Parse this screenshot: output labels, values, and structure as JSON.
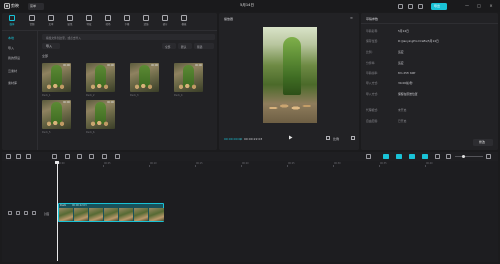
{
  "titlebar": {
    "app_name": "剪映",
    "menu_label": "菜单",
    "doc_title": "5月14日",
    "export_label": "导出",
    "window_controls": [
      "—",
      "□",
      "×"
    ]
  },
  "media_tools": [
    {
      "label": "媒体",
      "icon": "media-icon",
      "active": true
    },
    {
      "label": "音频",
      "icon": "audio-icon",
      "active": false
    },
    {
      "label": "文本",
      "icon": "text-icon",
      "active": false
    },
    {
      "label": "贴纸",
      "icon": "sticker-icon",
      "active": false
    },
    {
      "label": "特效",
      "icon": "effects-icon",
      "active": false
    },
    {
      "label": "转场",
      "icon": "transition-icon",
      "active": false
    },
    {
      "label": "字幕",
      "icon": "subtitle-icon",
      "active": false
    },
    {
      "label": "滤镜",
      "icon": "filter-icon",
      "active": false
    },
    {
      "label": "调节",
      "icon": "adjust-icon",
      "active": false
    },
    {
      "label": "模板",
      "icon": "template-icon",
      "active": false
    }
  ],
  "sidebar": {
    "items": [
      {
        "label": "本地",
        "active": true
      },
      {
        "label": "导入",
        "active": false
      },
      {
        "label": "我的预设",
        "active": false
      },
      {
        "label": "云素材",
        "active": false
      },
      {
        "label": "素材库",
        "active": false
      }
    ]
  },
  "import_bar": {
    "placeholder": "拖拽文件到这里，或点击导入"
  },
  "import_button": {
    "label": "导入"
  },
  "filters": {
    "all_label": "全部",
    "sort_label": "默认",
    "filter_label": "筛选"
  },
  "section_label": "全部",
  "media_items": [
    {
      "duration": "00:06",
      "name": "Duck_1"
    },
    {
      "duration": "00:06",
      "name": "Duck_2"
    },
    {
      "duration": "00:06",
      "name": "Duck_3"
    },
    {
      "duration": "00:06",
      "name": "Duck_4"
    },
    {
      "duration": "00:06",
      "name": "Duck_5"
    },
    {
      "duration": "00:06",
      "name": "Duck_6"
    }
  ],
  "player": {
    "title": "播放器",
    "menu": "≡",
    "time_current": "00:00:00:00",
    "time_separator": "/",
    "time_total": "00:00:22:03",
    "ratio_label": "比例"
  },
  "details": {
    "title": "草稿参数",
    "rows": [
      {
        "key": "草稿名称:",
        "value": "5月14日",
        "dim": false
      },
      {
        "key": "保存位置:",
        "value": "D:/JianyingPro Drafts/5月14日",
        "dim": false
      },
      {
        "key": "比例:",
        "value": "适应",
        "dim": false
      },
      {
        "key": "分辨率:",
        "value": "适应",
        "dim": false
      },
      {
        "key": "草稿帧率:",
        "value": "8m 25fr 60fr",
        "dim": false
      },
      {
        "key": "导入方式:",
        "value": "30.00帧/秒",
        "dim": false
      },
      {
        "key": "导入方式:",
        "value": "保留在原始位置",
        "dim": false
      },
      {
        "key": "代理模式:",
        "value": "未开启",
        "dim": true
      },
      {
        "key": "自由层级:",
        "value": "已开启",
        "dim": true
      }
    ],
    "edit_label": "修改"
  },
  "timeline": {
    "tick_labels": [
      "00:00",
      "00:05",
      "00:10",
      "00:15",
      "00:20",
      "00:25",
      "00:30",
      "00:35",
      "00:40"
    ],
    "track_label": "封面",
    "clip": {
      "name": "Duck",
      "duration": "00:00:22:03"
    }
  },
  "colors": {
    "accent": "#19c2d6",
    "panel": "#222225",
    "background": "#1b1b1d"
  }
}
